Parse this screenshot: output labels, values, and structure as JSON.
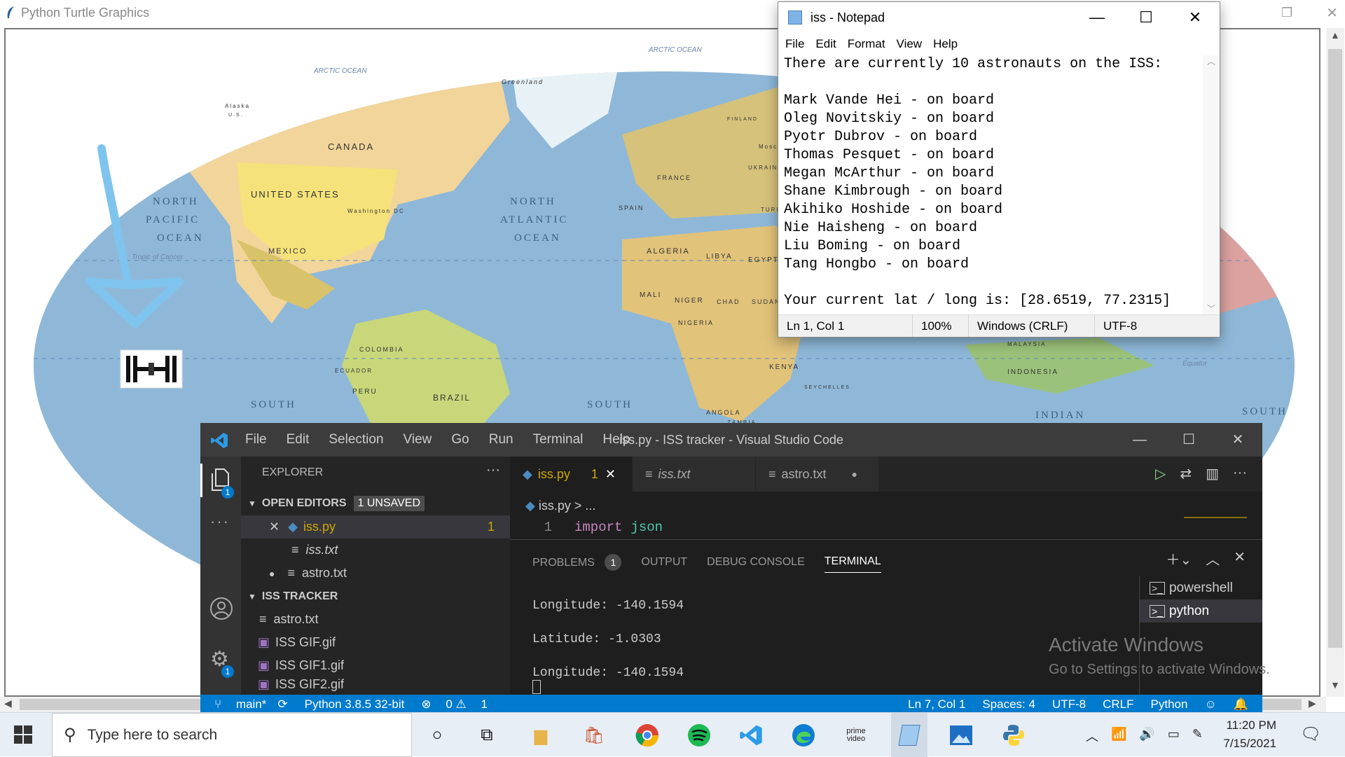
{
  "turtle": {
    "title": "Python Turtle Graphics",
    "icon": "feather-icon"
  },
  "map": {
    "labels": {
      "canada": "CANADA",
      "greenland": "Greenland",
      "alaska": "Alaska",
      "alaska_us": "U.S.",
      "arctic1": "ARCTIC OCEAN",
      "arctic2": "ARCTIC OCEAN",
      "us": "UNITED STATES",
      "washington": "Washington DC",
      "mexico": "MEXICO",
      "north_pacific": [
        "NORTH",
        "PACIFIC",
        "OCEAN"
      ],
      "north_atlantic": [
        "NORTH",
        "ATLANTIC",
        "OCEAN"
      ],
      "south1": "SOUTH",
      "south2": "SOUTH",
      "south3": "SOUTH",
      "brazil": "BRAZIL",
      "colombia": "COLOMBIA",
      "ecuador": "ECUADOR",
      "peru": "PERU",
      "algeria": "ALGERIA",
      "libya": "LIBYA",
      "egypt": "EGYPT",
      "mali": "MALI",
      "niger": "NIGER",
      "chad": "CHAD",
      "sudan": "SUDAN",
      "nigeria": "NIGERIA",
      "angola": "ANGOLA",
      "kenya": "KENYA",
      "zambia": "ZAMBIA",
      "indian": "INDIAN",
      "indonesia": "INDONESIA",
      "malaysia": "MALAYSIA",
      "seychelles": "SEYCHELLES",
      "equator": "Equator",
      "tropic": "Tropic of Cancer",
      "spain": "SPAIN",
      "france": "FRANCE",
      "ukraine": "UKRAINE",
      "turkey": "TURKEY",
      "finland": "FINLAND",
      "moscow": "Moscow"
    }
  },
  "notepad": {
    "title": "iss - Notepad",
    "menu": [
      "File",
      "Edit",
      "Format",
      "View",
      "Help"
    ],
    "text": "There are currently 10 astronauts on the ISS:\n\nMark Vande Hei - on board\nOleg Novitskiy - on board\nPyotr Dubrov - on board\nThomas Pesquet - on board\nMegan McArthur - on board\nShane Kimbrough - on board\nAkihiko Hoshide - on board\nNie Haisheng - on board\nLiu Boming - on board\nTang Hongbo - on board\n\nYour current lat / long is: [28.6519, 77.2315]",
    "status": {
      "position": "Ln 1, Col 1",
      "zoom": "100%",
      "eol": "Windows (CRLF)",
      "encoding": "UTF-8"
    }
  },
  "vscode": {
    "menu": [
      "File",
      "Edit",
      "Selection",
      "View",
      "Go",
      "Run",
      "Terminal",
      "Help"
    ],
    "window_title": "iss.py - ISS tracker - Visual Studio Code",
    "explorer_title": "EXPLORER",
    "explorer_more": "···",
    "open_editors": {
      "label": "OPEN EDITORS",
      "badge": "1 UNSAVED",
      "items": [
        {
          "name": "iss.py",
          "problems": "1"
        },
        {
          "name": "iss.txt"
        },
        {
          "name": "astro.txt"
        }
      ]
    },
    "project": {
      "label": "ISS TRACKER",
      "items": [
        "astro.txt",
        "ISS GIF.gif",
        "ISS GIF1.gif",
        "ISS GIF2.gif"
      ]
    },
    "tabs": [
      {
        "name": "iss.py",
        "problems": "1"
      },
      {
        "name": "iss.txt"
      },
      {
        "name": "astro.txt"
      }
    ],
    "breadcrumb": {
      "file": "iss.py",
      "sep": ">",
      "rest": "..."
    },
    "code": {
      "line": "1",
      "keyword": "import",
      "module": "json"
    },
    "panel": {
      "tabs": [
        "PROBLEMS",
        "OUTPUT",
        "DEBUG CONSOLE",
        "TERMINAL"
      ],
      "problems_count": "1",
      "terminal_lines": [
        "Longitude: -140.1594",
        "Latitude: -1.0303",
        "Longitude: -140.1594"
      ],
      "terminals": [
        "powershell",
        "python"
      ]
    },
    "explorer_badge": "1",
    "settings_badge": "1",
    "status": {
      "branch": "main*",
      "python": "Python 3.8.5 32-bit",
      "errors": "0",
      "warnings": "1",
      "position": "Ln 7, Col 1",
      "spaces": "Spaces: 4",
      "encoding": "UTF-8",
      "eol": "CRLF",
      "language": "Python"
    }
  },
  "watermark": {
    "title": "Activate Windows",
    "subtitle": "Go to Settings to activate Windows."
  },
  "taskbar": {
    "search_placeholder": "Type here to search",
    "time": "11:20 PM",
    "date": "7/15/2021",
    "prime_label": "prime video"
  },
  "colors": {
    "ocean": "#8fb8d8",
    "ocean_dark": "#6f9fc6",
    "vscode_blue": "#007acc",
    "iss_drawing": "#7fc4ee"
  }
}
